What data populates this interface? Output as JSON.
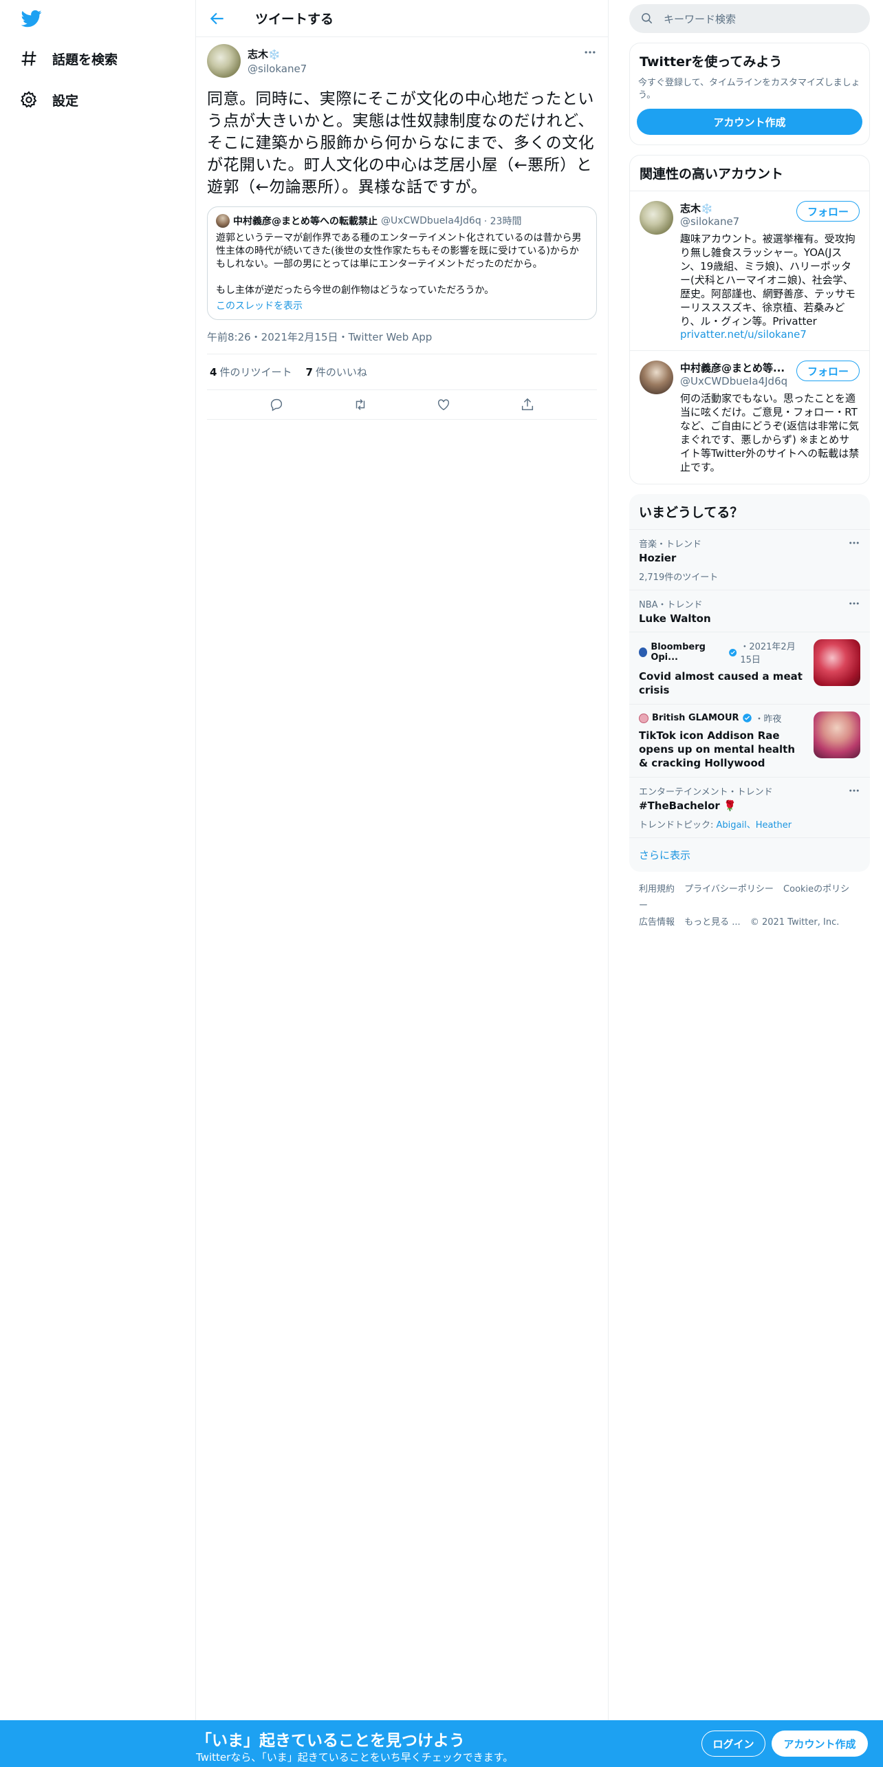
{
  "colors": {
    "accent": "#1da1f2",
    "bottom_bar": "#1da1f2",
    "text": "#0f1419",
    "secondary": "#5b7083"
  },
  "nav": {
    "logo_icon": "twitter-bird-icon",
    "items": [
      {
        "icon": "hashtag-icon",
        "label": "話題を検索"
      },
      {
        "icon": "gear-icon",
        "label": "設定"
      }
    ]
  },
  "header": {
    "back_icon": "arrow-left-icon",
    "title": "ツイートする"
  },
  "tweet": {
    "author_name": "志木",
    "author_emoji": "❄️",
    "author_handle": "@silokane7",
    "text": "同意。同時に、実際にそこが文化の中心地だったという点が大きいかと。実態は性奴隷制度なのだけれど、そこに建築から服飾から何からなにまで、多くの文化が花開いた。町人文化の中心は芝居小屋（←悪所）と遊郭（←勿論悪所）。異様な話ですが。",
    "quote": {
      "author_name": "中村義彦@まとめ等への転載禁止",
      "author_handle": "@UxCWDbueIa4Jd6q",
      "time": "· 23時間",
      "text": "遊郭というテーマが創作界である種のエンターテイメント化されているのは昔から男性主体の時代が続いてきた(後世の女性作家たちもその影響を既に受けている)からかもしれない。一部の男にとっては単にエンターテイメントだったのだから。\n\nもし主体が逆だったら今世の創作物はどうなっていただろうか。",
      "thread_link": "このスレッドを表示"
    },
    "meta": "午前8:26・2021年2月15日・Twitter Web App",
    "retweets_count": "4",
    "retweets_label": "件のリツイート",
    "likes_count": "7",
    "likes_label": "件のいいね"
  },
  "search": {
    "placeholder": "キーワード検索"
  },
  "signup_card": {
    "title": "Twitterを使ってみよう",
    "desc": "今すぐ登録して、タイムラインをカスタマイズしましょう。",
    "button": "アカウント作成"
  },
  "related": {
    "title": "関連性の高いアカウント",
    "follow_label": "フォロー",
    "accounts": [
      {
        "name": "志木",
        "emoji": "❄️",
        "handle": "@silokane7",
        "bio": "趣味アカウント。被選挙権有。受攻拘り無し雑食スラッシャー。YOA(Jスン、19歳組、ミラ娘)、ハリーポッター(犬科とハーマイオニ娘)、社会学、歴史。阿部謹也、網野善彦、テッサモーリスススズキ、徐京植、若桑みどり、ル・グィン等。Privatter",
        "url": "privatter.net/u/silokane7"
      },
      {
        "name": "中村義彦@まとめ等...",
        "handle": "@UxCWDbueIa4Jd6q",
        "bio": "何の活動家でもない。思ったことを適当に呟くだけ。ご意見・フォロー・RTなど、ご自由にどうぞ(返信は非常に気まぐれです、悪しからず) ※まとめサイト等Twitter外のサイトへの転載は禁止です。"
      }
    ]
  },
  "trends": {
    "title": "いまどうしてる？",
    "items": [
      {
        "context": "音楽・トレンド",
        "title": "Hozier",
        "count": "2,719件のツイート"
      },
      {
        "context": "NBA・トレンド",
        "title": "Luke Walton"
      }
    ],
    "news": [
      {
        "source": "Bloomberg Opi...",
        "time": "・2021年2月15日",
        "title": "Covid almost caused a meat crisis"
      },
      {
        "source": "British GLAMOUR",
        "time": "・昨夜",
        "title": "TikTok icon Addison Rae opens up on mental health & cracking Hollywood"
      }
    ],
    "topic_trend": {
      "context": "エンターテインメント・トレンド",
      "title": "#TheBachelor",
      "emoji": "🌹",
      "topic_label": "トレンドトピック: ",
      "topics": "Abigail、Heather"
    },
    "show_more": "さらに表示"
  },
  "footer": {
    "links": [
      "利用規約",
      "プライバシーポリシー",
      "Cookieのポリシー",
      "広告情報",
      "もっと見る ..."
    ],
    "copyright": "© 2021 Twitter, Inc."
  },
  "bottom_bar": {
    "title": "「いま」起きていることを見つけよう",
    "subtitle": "Twitterなら、「いま」起きていることをいち早くチェックできます。",
    "login": "ログイン",
    "signup": "アカウント作成"
  }
}
